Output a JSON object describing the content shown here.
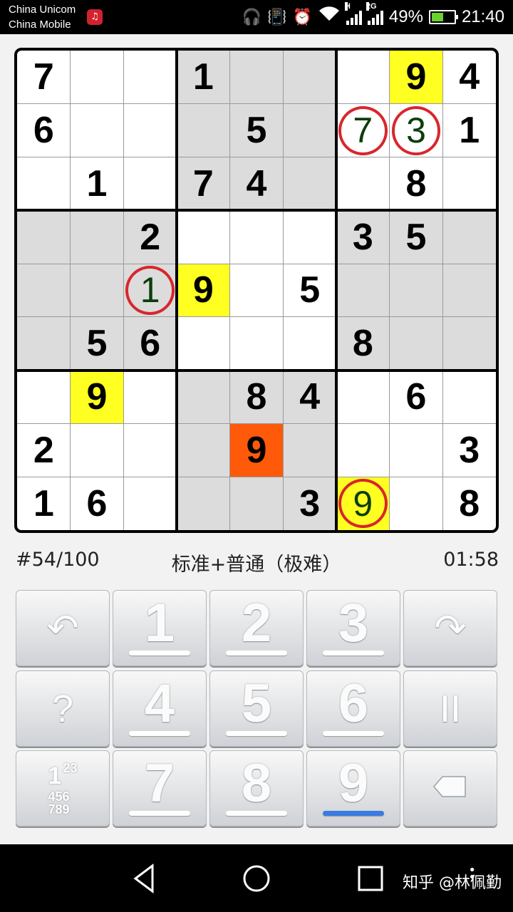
{
  "status_bar": {
    "carrier_1": "China Unicom",
    "carrier_2": "China Mobile",
    "network_1": "H",
    "network_2": "2G",
    "battery": "49%",
    "time": "21:40",
    "icons": [
      "netease-music-icon",
      "headphones-icon",
      "vibrate-icon",
      "alarm-icon",
      "wifi-icon",
      "signal-icon",
      "signal-icon",
      "battery-charging-icon"
    ]
  },
  "board": {
    "rows": [
      [
        "7",
        "",
        "",
        "1",
        "",
        "",
        "",
        "9",
        "4"
      ],
      [
        "6",
        "",
        "",
        "",
        "5",
        "",
        "7",
        "3",
        "1"
      ],
      [
        "",
        "1",
        "",
        "7",
        "4",
        "",
        "",
        "8",
        ""
      ],
      [
        "",
        "",
        "2",
        "",
        "",
        "",
        "3",
        "5",
        ""
      ],
      [
        "",
        "",
        "1",
        "9",
        "",
        "5",
        "",
        "",
        ""
      ],
      [
        "",
        "5",
        "6",
        "",
        "",
        "",
        "8",
        "",
        ""
      ],
      [
        "",
        "9",
        "",
        "",
        "8",
        "4",
        "",
        "6",
        ""
      ],
      [
        "2",
        "",
        "",
        "",
        "9",
        "",
        "",
        "",
        "3"
      ],
      [
        "1",
        "6",
        "",
        "",
        "",
        "3",
        "9",
        "",
        "8"
      ]
    ],
    "candidate_cells": [
      [
        1,
        6
      ],
      [
        1,
        7
      ],
      [
        4,
        2
      ],
      [
        8,
        6
      ]
    ],
    "yellow_cells": [
      [
        0,
        7
      ],
      [
        4,
        3
      ],
      [
        6,
        1
      ],
      [
        8,
        6
      ]
    ],
    "orange_cells": [
      [
        7,
        4
      ]
    ],
    "circled_cells": [
      [
        1,
        6
      ],
      [
        1,
        7
      ],
      [
        4,
        2
      ],
      [
        8,
        6
      ]
    ],
    "colors": {
      "yellow": "#ffff22",
      "orange": "#ff5a0a",
      "circle": "#d8262d",
      "candidate_text": "#0b3d0b",
      "shaded_box": "#dcdcdc"
    }
  },
  "info": {
    "puzzle_number": "#54/100",
    "mode": "标准+普通（极难）",
    "timer": "01:58"
  },
  "keypad": {
    "undo_icon": "undo-icon",
    "redo_icon": "redo-icon",
    "hint_icon": "help-icon",
    "hint_label": "?",
    "pause_icon": "pause-icon",
    "pause_label": "II",
    "numbers_icon": "candidate-grid-icon",
    "numbers_label_big": "1",
    "numbers_label_rows": [
      "23",
      "456",
      "789"
    ],
    "delete_icon": "eraser-icon",
    "digits": [
      "1",
      "2",
      "3",
      "4",
      "5",
      "6",
      "7",
      "8",
      "9"
    ],
    "active_digit": "9",
    "active_color": "#3a7be0"
  },
  "nav_bar": {
    "icons": [
      "back-icon",
      "home-icon",
      "recent-apps-icon",
      "menu-dots-icon"
    ],
    "watermark": "知乎 @林佩勤"
  }
}
